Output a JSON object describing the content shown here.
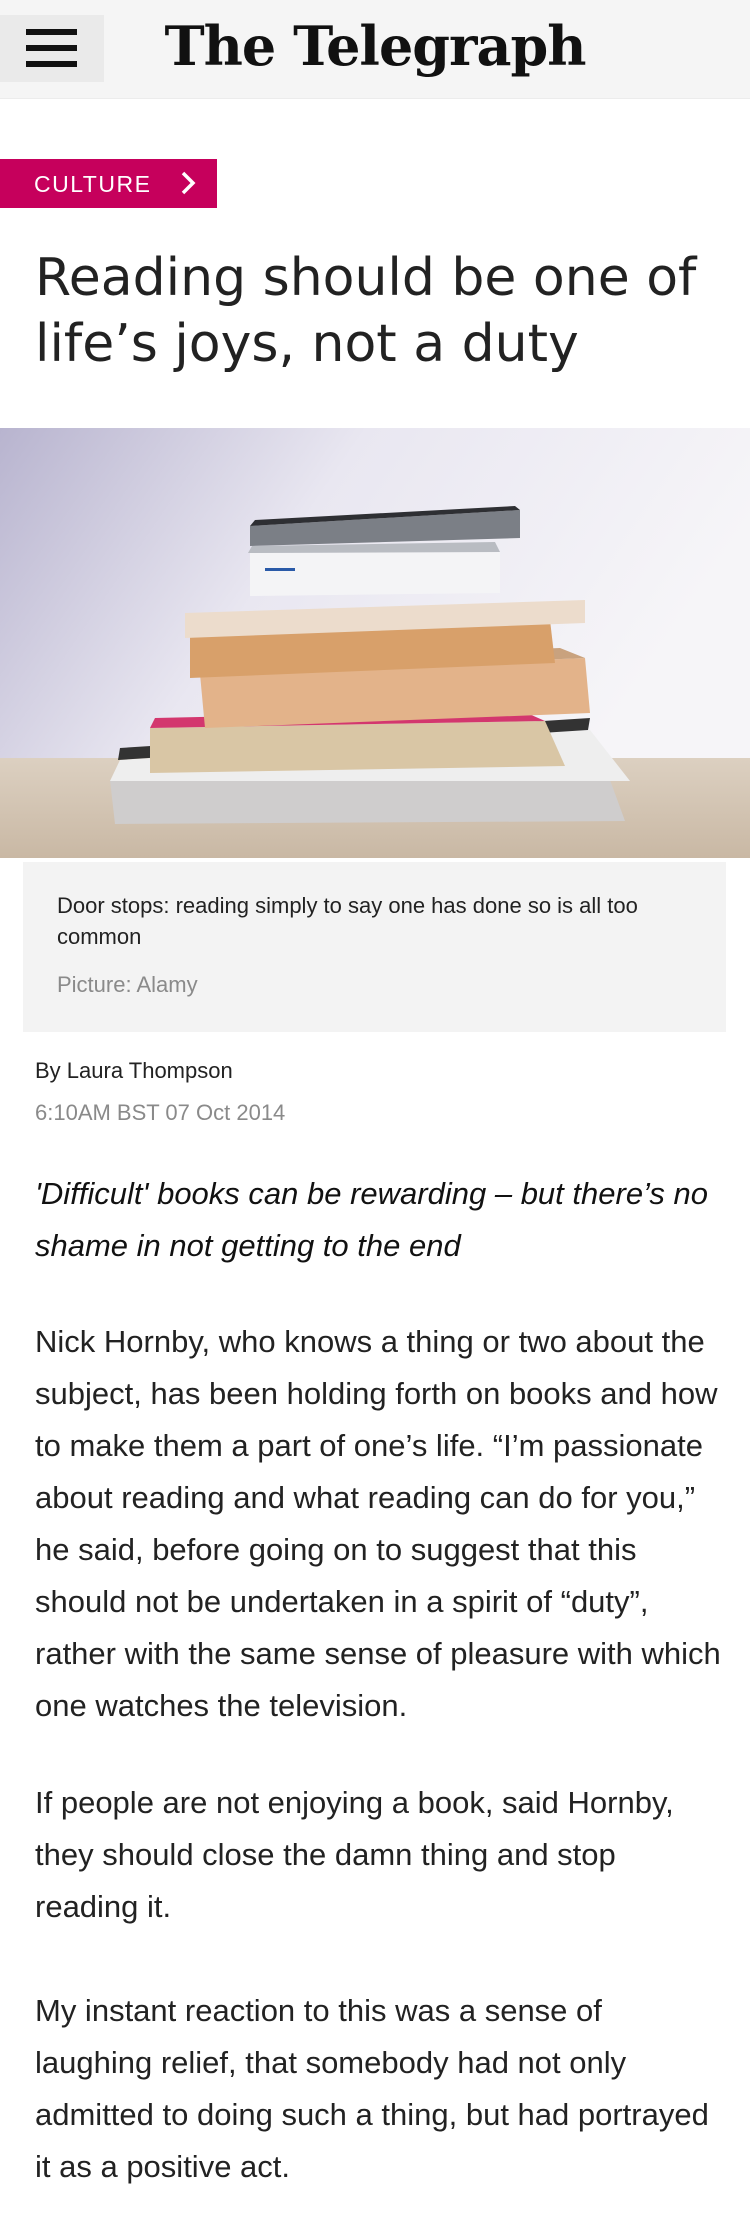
{
  "header": {
    "logo_text": "The Telegraph",
    "menu_icon": "hamburger-menu-icon"
  },
  "section": {
    "label": "CULTURE",
    "icon": "chevron-right-icon",
    "color": "#c6005c"
  },
  "article": {
    "headline": "Reading should be one of life’s joys, not a duty",
    "image": {
      "caption": "Door stops: reading simply to say one has done so is all too common",
      "credit": "Picture: Alamy"
    },
    "byline": "By Laura Thompson",
    "date": "6:10AM BST 07 Oct 2014",
    "standfirst": "'Difficult' books can be rewarding – but there’s no shame in not getting to the end",
    "paragraphs": [
      "Nick Hornby, who knows a thing or two about the subject, has been holding forth on books and how to make them a part of one’s life. “I’m passionate about reading and what reading can do for you,” he said, before going on to suggest that this should not be undertaken in a spirit of “duty”, rather with the same sense of pleasure with which one watches the television.",
      "If people are not enjoying a book, said Hornby, they should close the damn thing and stop reading it.",
      "My instant reaction to this was a sense of laughing relief, that somebody had not only admitted to doing such a thing, but had portrayed it as a positive act."
    ]
  }
}
